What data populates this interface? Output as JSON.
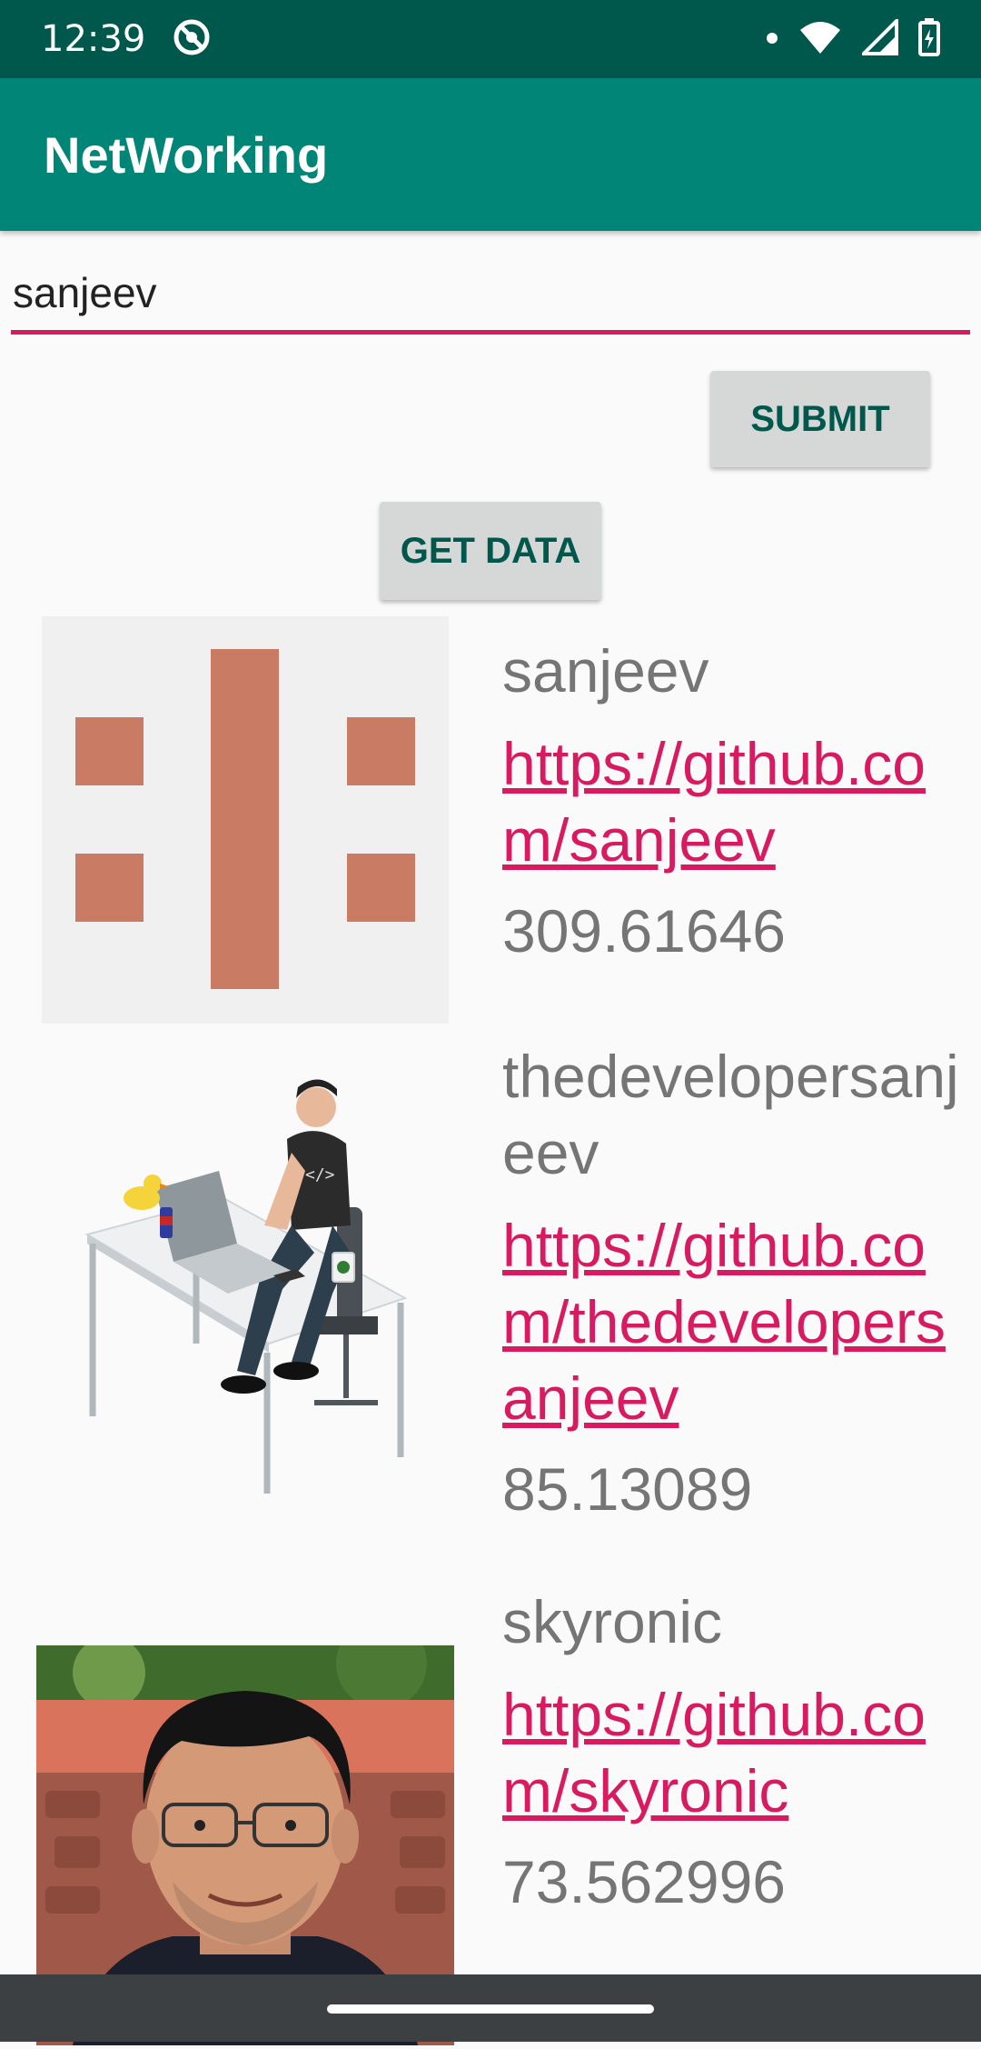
{
  "status_bar": {
    "time": "12:39",
    "icons": [
      "do-not-disturb-icon",
      "notification-dot-icon",
      "wifi-icon",
      "cell-signal-icon",
      "battery-icon"
    ]
  },
  "app_bar": {
    "title": "NetWorking"
  },
  "search": {
    "value": "sanjeev",
    "placeholder": ""
  },
  "buttons": {
    "submit": "SUBMIT",
    "get_data": "GET DATA"
  },
  "results": [
    {
      "name": "sanjeev",
      "url": "https://github.com/sanjeev",
      "score": "309.61646",
      "avatar": "identicon"
    },
    {
      "name": "thedevelopersanjeev",
      "url": "https://github.com/thedevelopersanjeev",
      "score": "85.13089",
      "avatar": "developer-illustration"
    },
    {
      "name": "skyronic",
      "url": "https://github.com/skyronic",
      "score": "73.562996",
      "avatar": "profile-photo"
    }
  ],
  "colors": {
    "status_bar": "#00574b",
    "app_bar": "#008577",
    "accent": "#d81b60",
    "text_secondary": "#757575",
    "identicon": "#c97b63"
  }
}
